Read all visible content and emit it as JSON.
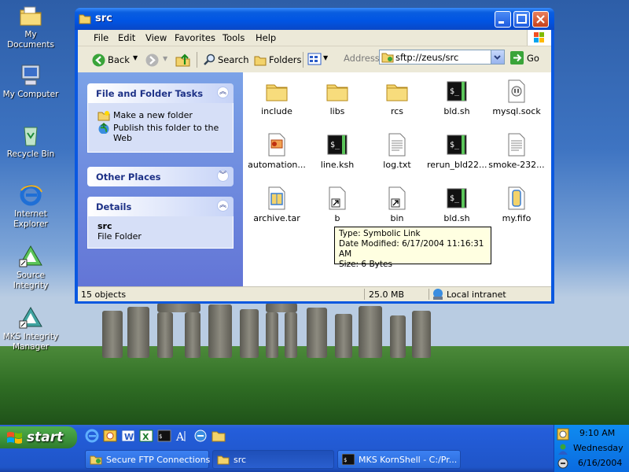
{
  "desktop": {
    "icons": [
      {
        "label_1": "My Documents",
        "label_2": ""
      },
      {
        "label_1": "My Computer",
        "label_2": ""
      },
      {
        "label_1": "Recycle Bin",
        "label_2": ""
      },
      {
        "label_1": "Internet",
        "label_2": "Explorer"
      },
      {
        "label_1": "Source",
        "label_2": "Integrity"
      },
      {
        "label_1": "MKS Integrity",
        "label_2": "Manager"
      }
    ]
  },
  "window": {
    "title": "src",
    "menu": [
      "File",
      "Edit",
      "View",
      "Favorites",
      "Tools",
      "Help"
    ],
    "toolbar": {
      "back": "Back",
      "search": "Search",
      "folders": "Folders",
      "address_label": "Address",
      "address_value": "sftp://zeus/src",
      "go": "Go"
    },
    "tasks_panel": {
      "title": "File and Folder Tasks",
      "links": [
        "Make a new folder",
        "Publish this folder to the Web"
      ]
    },
    "other_places": {
      "title": "Other Places"
    },
    "details": {
      "title": "Details",
      "name": "src",
      "type": "File Folder"
    },
    "items": [
      {
        "name": "include",
        "icon": "folder-icon"
      },
      {
        "name": "libs",
        "icon": "folder-icon"
      },
      {
        "name": "rcs",
        "icon": "folder-icon"
      },
      {
        "name": "bld.sh",
        "icon": "shell-script-icon"
      },
      {
        "name": "mysql.sock",
        "icon": "socket-icon"
      },
      {
        "name": "automation...",
        "icon": "html-document-icon"
      },
      {
        "name": "line.ksh",
        "icon": "shell-script-icon"
      },
      {
        "name": "log.txt",
        "icon": "text-file-icon"
      },
      {
        "name": "rerun_bld22...",
        "icon": "shell-script-icon"
      },
      {
        "name": "smoke-232...",
        "icon": "text-file-icon"
      },
      {
        "name": "archive.tar",
        "icon": "archive-icon"
      },
      {
        "name": "b",
        "icon": "symlink-icon"
      },
      {
        "name": "bin",
        "icon": "symlink-icon"
      },
      {
        "name": "bld.sh",
        "icon": "shell-script-icon"
      },
      {
        "name": "my.fifo",
        "icon": "fifo-icon"
      }
    ],
    "tooltip": {
      "type": "Type: Symbolic Link",
      "modified": "Date Modified: 6/17/2004 11:16:31 AM",
      "size": "Size: 6 Bytes"
    },
    "status": {
      "objects": "15 objects",
      "size": "25.0 MB",
      "zone": "Local intranet"
    }
  },
  "taskbar": {
    "start": "start",
    "tasks": [
      "Secure FTP Connections",
      "src",
      "MKS KornShell - C:/Pr..."
    ],
    "clock": {
      "time": "9:10 AM",
      "day": "Wednesday",
      "date": "6/16/2004"
    }
  },
  "colors": {
    "xp_blue": "#0054e3",
    "start_green": "#3c913a",
    "task_pane": "#6375d6"
  }
}
